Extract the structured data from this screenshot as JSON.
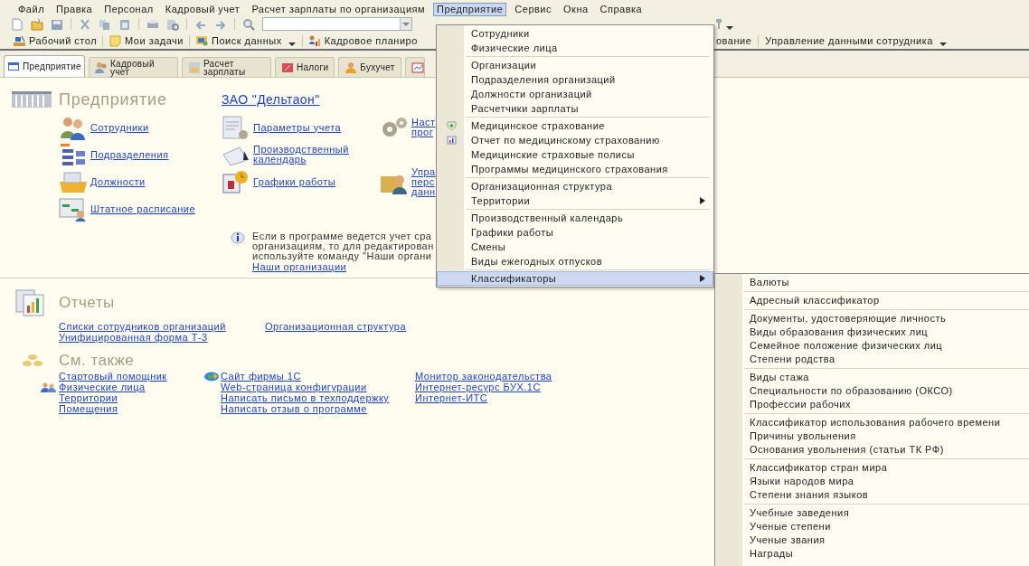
{
  "menu_bar": [
    {
      "label": "Файл",
      "selected": false
    },
    {
      "label": "Правка",
      "selected": false
    },
    {
      "label": "Персонал",
      "selected": false
    },
    {
      "label": "Кадровый учет",
      "selected": false
    },
    {
      "label": "Расчет зарплаты по организациям",
      "selected": false
    },
    {
      "label": "Предприятие",
      "selected": true
    },
    {
      "label": "Сервис",
      "selected": false
    },
    {
      "label": "Окна",
      "selected": false
    },
    {
      "label": "Справка",
      "selected": false
    }
  ],
  "nav_bar": {
    "left": [
      {
        "label": "Рабочий стол",
        "has_dropdown": false
      },
      {
        "label": "Мои задачи",
        "has_dropdown": false
      },
      {
        "label": "Поиск данных",
        "has_dropdown": true
      },
      {
        "label": "Кадровое планиро",
        "has_dropdown": false
      }
    ],
    "right": [
      {
        "label": "ование",
        "has_dropdown": false
      },
      {
        "label": "Управление данными сотрудника",
        "has_dropdown": true
      }
    ]
  },
  "tabs": [
    {
      "kind": "text",
      "label": "Предприятие",
      "selected": true
    },
    {
      "kind": "text",
      "label": "Кадровый учет",
      "selected": false
    },
    {
      "kind": "text",
      "label": "Расчет зарплаты",
      "selected": false
    },
    {
      "kind": "text",
      "label": "Налоги",
      "selected": false
    },
    {
      "kind": "text",
      "label": "Бухучет",
      "selected": false
    },
    {
      "kind": "icon",
      "selected": false
    }
  ],
  "enterprise": {
    "title": "Предприятие",
    "organization": "ЗАО \"Дельтаон\"",
    "link_rows": [
      [
        {
          "lines": [
            "Сотрудники"
          ]
        },
        {
          "lines": [
            "Параметры учета"
          ]
        },
        {
          "lines": [
            "Наст",
            "прог"
          ]
        }
      ],
      [
        {
          "lines": [
            "Подразделения"
          ]
        },
        {
          "lines": [
            "Производственный",
            "календарь"
          ]
        }
      ],
      [
        {
          "lines": [
            "Должности"
          ]
        },
        {
          "lines": [
            "Графики  работы"
          ]
        },
        {
          "lines": [
            "Упра",
            "перс",
            "данн"
          ]
        }
      ],
      [
        {
          "lines": [
            "Штатное расписание"
          ]
        }
      ]
    ],
    "note": {
      "lines": [
        "Если в программе ведется учет сра",
        "организациям, то для редактирован",
        "используйте команду \"Наши органи"
      ],
      "link": "Наши организации"
    }
  },
  "reports": {
    "title": "Отчеты",
    "columns": [
      [
        "Списки сотрудников организаций",
        "Унифицированная форма Т-3"
      ],
      [
        "Организационная структура"
      ]
    ]
  },
  "see_also": {
    "title": "См. также",
    "columns": [
      [
        "Стартовый помощник",
        "Физические лица",
        "Территории",
        "Помещения"
      ],
      [
        "Сайт фирмы 1С",
        "Web-страница конфигурации",
        "Написать письмо в техподдержку",
        "Написать отзыв о программе"
      ],
      [
        "Монитор законодательства",
        "Интернет-ресурс БУХ.1С",
        "Интернет-ИТС"
      ]
    ]
  },
  "dropdown": {
    "groups": [
      [
        {
          "label": "Сотрудники",
          "selected": false,
          "has_submenu": false
        },
        {
          "label": "Физические лица",
          "selected": false,
          "has_submenu": false
        }
      ],
      [
        {
          "label": "Организации",
          "selected": false,
          "has_submenu": false
        },
        {
          "label": "Подразделения организаций",
          "selected": false,
          "has_submenu": false
        },
        {
          "label": "Должности организаций",
          "selected": false,
          "has_submenu": false
        },
        {
          "label": "Расчетчики зарплаты",
          "selected": false,
          "has_submenu": false
        }
      ],
      [
        {
          "label": "Медицинское страхование",
          "selected": false,
          "has_submenu": false
        },
        {
          "label": "Отчет по медицинскому страхованию",
          "selected": false,
          "has_submenu": false
        },
        {
          "label": "Медицинские страховые полисы",
          "selected": false,
          "has_submenu": false
        },
        {
          "label": "Программы медицинского страхования",
          "selected": false,
          "has_submenu": false
        }
      ],
      [
        {
          "label": "Организационная структура",
          "selected": false,
          "has_submenu": false
        },
        {
          "label": "Территории",
          "selected": false,
          "has_submenu": true
        }
      ],
      [
        {
          "label": "Производственный календарь",
          "selected": false,
          "has_submenu": false
        },
        {
          "label": "Графики работы",
          "selected": false,
          "has_submenu": false
        },
        {
          "label": "Смены",
          "selected": false,
          "has_submenu": false
        },
        {
          "label": "Виды ежегодных отпусков",
          "selected": false,
          "has_submenu": false
        }
      ],
      [
        {
          "label": "Классификаторы",
          "selected": true,
          "has_submenu": true
        }
      ]
    ]
  },
  "submenu": {
    "groups": [
      [
        "Валюты"
      ],
      [
        "Адресный классификатор"
      ],
      [
        "Документы, удостоверяющие личность",
        "Виды образования физических лиц",
        "Семейное положение физических лиц",
        "Степени родства"
      ],
      [
        "Виды стажа",
        "Специальности по образованию (ОКСО)",
        "Профессии рабочих"
      ],
      [
        "Классификатор использования рабочего времени",
        "Причины увольнения",
        "Основания увольнения (статьи ТК РФ)"
      ],
      [
        "Классификатор стран мира",
        "Языки народов мира",
        "Степени знания языков"
      ],
      [
        "Учебные заведения",
        "Ученые степени",
        "Ученые звания",
        "Награды"
      ]
    ]
  }
}
